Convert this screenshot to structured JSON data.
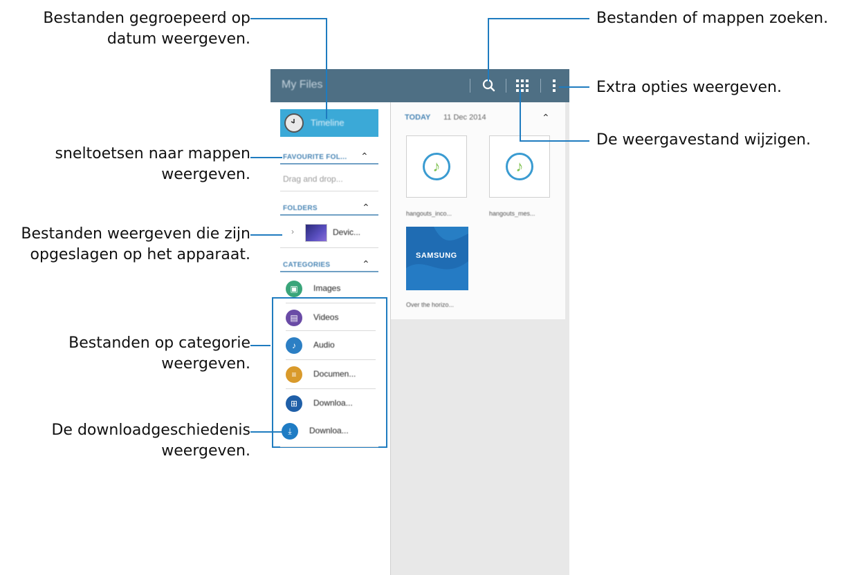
{
  "annotations": {
    "timeline": [
      "Bestanden gegroepeerd op",
      "datum weergeven."
    ],
    "favourites": [
      "sneltoetsen naar mappen",
      "weergeven."
    ],
    "device": [
      "Bestanden weergeven die zijn",
      "opgeslagen op het apparaat."
    ],
    "categories": [
      "Bestanden op categorie",
      "weergeven."
    ],
    "downloads": [
      "De downloadgeschiedenis",
      "weergeven."
    ],
    "search": "Bestanden of mappen zoeken.",
    "more": "Extra opties weergeven.",
    "view": "De weergavestand wijzigen."
  },
  "app": {
    "title": "My Files",
    "icons": {
      "search": "search-icon",
      "grid": "grid-view-icon",
      "more": "more-options-icon"
    }
  },
  "sidebar": {
    "timeline_label": "Timeline",
    "favourites_header": "FAVOURITE FOL...",
    "favourites_hint": "Drag and drop...",
    "folders_header": "FOLDERS",
    "folder_item": "Devic...",
    "categories_header": "CATEGORIES",
    "categories": [
      {
        "label": "Images",
        "icon": "image-icon",
        "color": "#3aa57a"
      },
      {
        "label": "Videos",
        "icon": "video-icon",
        "color": "#6a4ba6"
      },
      {
        "label": "Audio",
        "icon": "music-note-icon",
        "color": "#2c7fc4"
      },
      {
        "label": "Documen...",
        "icon": "document-icon",
        "color": "#d99a2b"
      },
      {
        "label": "Downloa...",
        "icon": "apps-icon",
        "color": "#1f5fa8"
      }
    ],
    "download_history": {
      "label": "Downloa...",
      "icon": "download-icon",
      "color": "#1f7cc4"
    }
  },
  "content": {
    "date_header_label": "TODAY",
    "date_header_date": "11 Dec 2014",
    "files": [
      {
        "name": "hangouts_inco...",
        "type": "audio"
      },
      {
        "name": "hangouts_mes...",
        "type": "audio"
      },
      {
        "name": "Over the horizo...",
        "type": "samsung-image",
        "wordmark": "SAMSUNG"
      }
    ]
  }
}
